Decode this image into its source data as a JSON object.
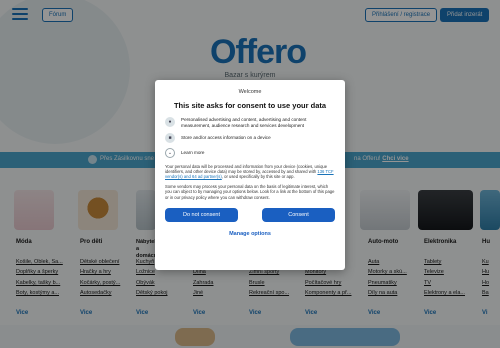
{
  "header": {
    "forum_label": "Fórum",
    "login_label": "Přihlášení / registrace",
    "add_label": "Přidat inzerát"
  },
  "brand": {
    "logo_text": "Offero",
    "tagline": "Bazar s kurýrem"
  },
  "promo": {
    "left_text": "Přes Zásilkovnu sne",
    "right_text": "na Offeru!",
    "right_link": "Chci vice"
  },
  "categories": [
    {
      "title": "Móda",
      "links": [
        "Košile, Oblek, Sa...",
        "Doplňky a šperky",
        "Kabelky, tašky b...",
        "Boty, kostýmy a..."
      ],
      "more": "Vice"
    },
    {
      "title": "Pro děti",
      "links": [
        "Dětské oblečení",
        "Hračky a hry",
        "Kočárky, postý...",
        "Autosedačky"
      ],
      "more": "Vice"
    },
    {
      "title": "Nábytek a domácnost",
      "links": [
        "Kuchyň",
        "Ložnice",
        "Obývák",
        "Dětský pokoj"
      ],
      "more": "Vice"
    },
    {
      "title": "",
      "links": [
        "Dílna",
        "Zahrada",
        "Jiné"
      ],
      "more": "Vice"
    },
    {
      "title": "",
      "links": [
        "Zimní sporty",
        "Brusle",
        "Rekreační spo..."
      ],
      "more": "Vice"
    },
    {
      "title": "",
      "links": [
        "Monitory",
        "Počítačové hry",
        "Komponenty a př..."
      ],
      "more": "Vice"
    },
    {
      "title": "Auto-moto",
      "links": [
        "Auta",
        "Motorky a skú...",
        "Pneumatiky",
        "Díly na auta"
      ],
      "more": "Vice"
    },
    {
      "title": "Elektronika",
      "links": [
        "Tablety",
        "Televize",
        "TV",
        "Elektrony a ela..."
      ],
      "more": "Vice"
    },
    {
      "title": "Hu",
      "links": [
        "Ku",
        "Hu",
        "Ho",
        "Ba"
      ],
      "more": "Vi"
    }
  ],
  "consent": {
    "welcome": "Welcome",
    "title": "This site asks for consent to use your data",
    "purposes": [
      {
        "icon": "person-icon",
        "text": "Personalised advertising and content, advertising and content measurement, audience research and services development"
      },
      {
        "icon": "device-icon",
        "text": "Store and/or access information on a device"
      }
    ],
    "learn_more": "Learn more",
    "paragraph1_a": "Your personal data will be processed and information from your device (cookies, unique identifiers, and other device data) may be stored by, accessed by and shared with ",
    "paragraph1_link": "136 TCF vendor(s) and 64 ad partner(s)",
    "paragraph1_b": ", or used specifically by this site or app.",
    "paragraph2": "Some vendors may process your personal data on the basis of legitimate interest, which you can object to by managing your options below. Look for a link at the bottom of this page or in our privacy policy where you can withdraw consent.",
    "do_not_consent": "Do not consent",
    "consent": "Consent",
    "manage_options": "Manage options"
  },
  "colors": {
    "brand": "#1a73b8",
    "dialog_button": "#1a5fc1",
    "promo_bar": "#4ba6ce"
  }
}
